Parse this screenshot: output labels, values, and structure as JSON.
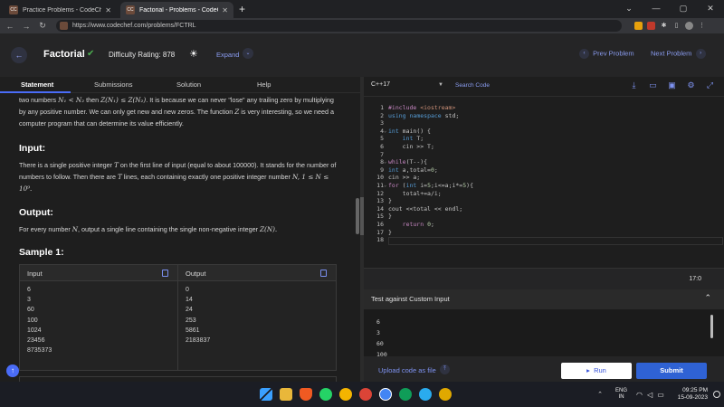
{
  "browser": {
    "tabs": [
      {
        "title": "Practice Problems - CodeChef",
        "active": false
      },
      {
        "title": "Factorial - Problems - CodeChef",
        "active": true
      }
    ],
    "favicon_text": "CC",
    "url": "https://www.codechef.com/problems/FCTRL"
  },
  "header": {
    "title": "Factorial",
    "difficulty": "Difficulty Rating: 878",
    "expand": "Expand",
    "prev": "Prev Problem",
    "next": "Next Problem"
  },
  "left_tabs": [
    "Statement",
    "Submissions",
    "Solution",
    "Help"
  ],
  "statement": {
    "intro_prefix": "two numbers",
    "intro_mid": "then",
    "intro_suffix": ". It is because we can never \"lose\" any trailing zero by multiplying by any positive number. We can only get new and new zeros. The function",
    "intro_end": "is very interesting, so we need a computer program that can determine its value efficiently.",
    "math_n1n2": "N₁ < N₂",
    "math_zineq": "Z(N₁) ≤ Z(N₂)",
    "math_z": "Z",
    "input_heading": "Input:",
    "input_p1": "There is a single positive integer",
    "input_T": "T",
    "input_p2": "on the first line of input (equal to about 100000). It stands for the number of numbers to follow. Then there are",
    "input_p3": "lines, each containing exactly one positive integer number",
    "input_N": "N, 1 ≤ N ≤ 10⁹.",
    "output_heading": "Output:",
    "output_p1": "For every number",
    "output_N": "N",
    "output_p2": ", output a single line containing the single non-negative integer",
    "output_ZN": "Z(N).",
    "sample_heading": "Sample 1:",
    "sample_input_label": "Input",
    "sample_output_label": "Output",
    "sample_input": [
      "6",
      "3",
      "60",
      "100",
      "1024",
      "23456",
      "8735373"
    ],
    "sample_output": [
      "0",
      "14",
      "24",
      "253",
      "5861",
      "2183837"
    ]
  },
  "editor": {
    "language": "C++17",
    "search": "Search Code",
    "line_numbers": [
      "1",
      "2",
      "3",
      "4",
      "5",
      "6",
      "7",
      "8",
      "9",
      "10",
      "11",
      "12",
      "13",
      "14",
      "15",
      "16",
      "17",
      "18"
    ],
    "cursor_pos": "17:0"
  },
  "custom_input": {
    "title": "Test against Custom Input",
    "lines": [
      "6",
      "3",
      "60",
      "100"
    ]
  },
  "footer": {
    "upload": "Upload code as file",
    "run": "Run",
    "submit": "Submit"
  },
  "taskbar": {
    "lang_top": "ENG",
    "lang_bottom": "IN",
    "time": "09:25 PM",
    "date": "15-09-2023"
  },
  "colors": {
    "accent": "#4a6cf7",
    "submit": "#2f62d4",
    "solved": "#4caf50"
  }
}
